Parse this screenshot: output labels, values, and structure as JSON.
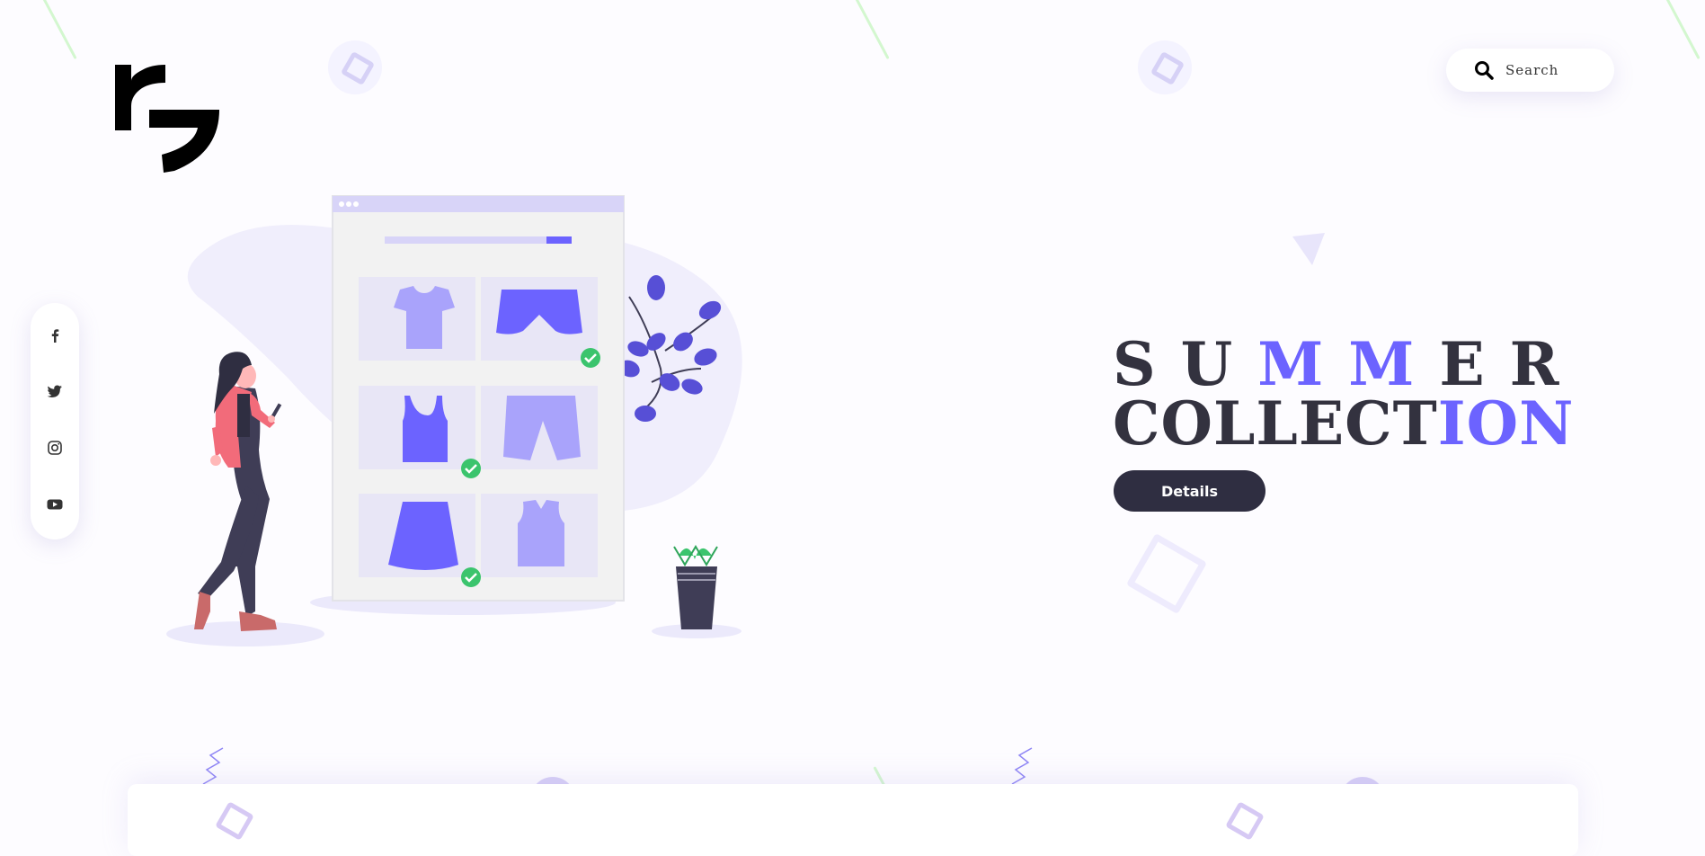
{
  "app": {
    "logo_icon": "brand-logo-icon"
  },
  "search": {
    "icon": "search-icon",
    "placeholder": "Search"
  },
  "social": [
    {
      "name": "facebook",
      "icon": "facebook-icon"
    },
    {
      "name": "twitter",
      "icon": "twitter-icon"
    },
    {
      "name": "instagram",
      "icon": "instagram-icon"
    },
    {
      "name": "youtube",
      "icon": "youtube-icon"
    }
  ],
  "hero": {
    "line1_plain_a": "SU",
    "line1_accent": "MM",
    "line1_plain_b": "ER",
    "line2_plain": "COLLECT",
    "line2_accent": "ION",
    "details_label": "Details",
    "illustration": "online-shopping-illustration"
  },
  "colors": {
    "accent": "#6c63ff",
    "dark": "#2f2e41",
    "check": "#3bc46d",
    "light_purple": "#edebfd"
  }
}
